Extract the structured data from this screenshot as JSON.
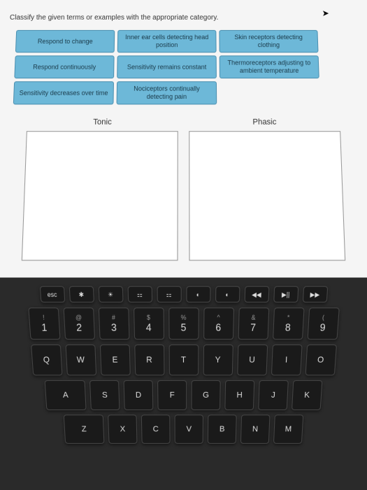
{
  "instruction": "Classify the given terms or examples with the appropriate category.",
  "cards": [
    [
      "Respond to change",
      "Inner ear cells detecting head position",
      "Skin receptors detecting clothing"
    ],
    [
      "Respond continuously",
      "Sensitivity remains constant",
      "Thermoreceptors adjusting to ambient temperature"
    ],
    [
      "Sensitivity decreases over time",
      "Nociceptors continually detecting pain"
    ]
  ],
  "categories": {
    "left": "Tonic",
    "right": "Phasic"
  },
  "keyboard": {
    "fn_row": [
      "esc",
      "✱",
      "☀",
      "⚏",
      "⚏",
      "◐",
      "◐",
      "◀◀",
      "▶||",
      "▶▶"
    ],
    "num_row": [
      {
        "top": "!",
        "main": "1"
      },
      {
        "top": "@",
        "main": "2"
      },
      {
        "top": "#",
        "main": "3"
      },
      {
        "top": "$",
        "main": "4"
      },
      {
        "top": "%",
        "main": "5"
      },
      {
        "top": "^",
        "main": "6"
      },
      {
        "top": "&",
        "main": "7"
      },
      {
        "top": "*",
        "main": "8"
      },
      {
        "top": "(",
        "main": "9"
      }
    ],
    "row_q": [
      "Q",
      "W",
      "E",
      "R",
      "T",
      "Y",
      "U",
      "I",
      "O"
    ],
    "row_a": [
      "A",
      "S",
      "D",
      "F",
      "G",
      "H",
      "J",
      "K"
    ],
    "row_z": [
      "Z",
      "X",
      "C",
      "V",
      "B",
      "N",
      "M"
    ]
  }
}
